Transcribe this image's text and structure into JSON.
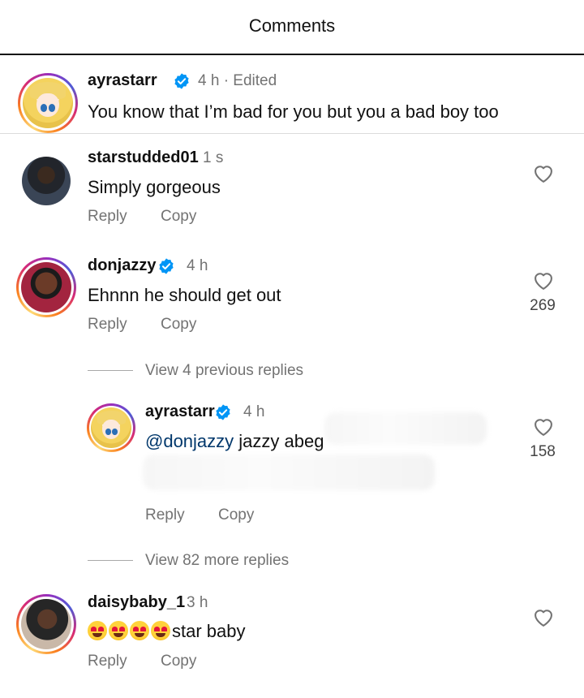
{
  "header": {
    "title": "Comments"
  },
  "caption": {
    "username": "ayrastarr",
    "verified": true,
    "meta": "4 h · Edited",
    "text": "You know that I’m bad for you but you a bad boy too"
  },
  "comments": [
    {
      "username": "starstudded01",
      "verified": false,
      "time": "1 s",
      "text": "Simply gorgeous",
      "reply_label": "Reply",
      "copy_label": "Copy",
      "likes": ""
    },
    {
      "username": "donjazzy",
      "verified": true,
      "time": "4 h",
      "text": "Ehnnn he should get out",
      "reply_label": "Reply",
      "copy_label": "Copy",
      "likes": "269",
      "view_previous": "View 4 previous replies",
      "reply": {
        "username": "ayrastarr",
        "verified": true,
        "time": "4 h",
        "mention": "@donjazzy",
        "text": " jazzy abeg",
        "reply_label": "Reply",
        "copy_label": "Copy",
        "likes": "158"
      },
      "view_more": "View 82 more replies"
    },
    {
      "username": "daisybaby_1",
      "verified": false,
      "time": "3 h",
      "emoji": "heart-eyes-emoji",
      "emoji_count": 4,
      "text": "star baby",
      "reply_label": "Reply",
      "copy_label": "Copy",
      "likes": ""
    }
  ],
  "colors": {
    "verified": "#0095f6",
    "muted": "#737373",
    "mention": "#00376b"
  }
}
